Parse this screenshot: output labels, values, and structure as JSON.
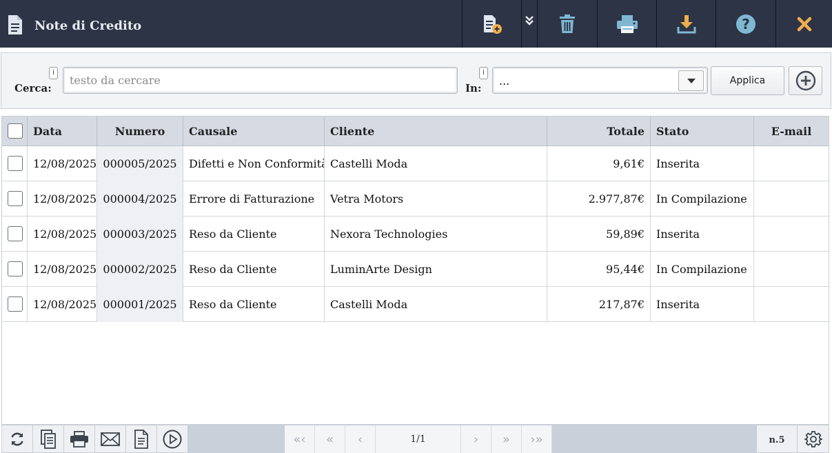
{
  "header": {
    "title": "Note di Credito",
    "icons": [
      "document-icon",
      "new-document-icon",
      "expand-more-icon",
      "trash-icon",
      "print-icon",
      "download-icon",
      "help-icon",
      "close-icon"
    ]
  },
  "search": {
    "cerca_label": "Cerca:",
    "in_label": "In:",
    "info_glyph": "i",
    "placeholder": "testo da cercare",
    "value": "",
    "in_value": "...",
    "apply_label": "Applica"
  },
  "table": {
    "columns": [
      "Data",
      "Numero",
      "Causale",
      "Cliente",
      "Totale",
      "Stato",
      "E-mail"
    ],
    "rows": [
      {
        "data": "12/08/2025",
        "numero": "000005/2025",
        "causale": "Difetti e Non Conformità",
        "cliente": "Castelli Moda",
        "totale": "9,61€",
        "stato": "Inserita",
        "email": ""
      },
      {
        "data": "12/08/2025",
        "numero": "000004/2025",
        "causale": "Errore di Fatturazione",
        "cliente": "Vetra Motors",
        "totale": "2.977,87€",
        "stato": "In Compilazione",
        "email": ""
      },
      {
        "data": "12/08/2025",
        "numero": "000003/2025",
        "causale": "Reso da Cliente",
        "cliente": "Nexora Technologies",
        "totale": "59,89€",
        "stato": "Inserita",
        "email": ""
      },
      {
        "data": "12/08/2025",
        "numero": "000002/2025",
        "causale": "Reso da Cliente",
        "cliente": "LuminArte Design",
        "totale": "95,44€",
        "stato": "In Compilazione",
        "email": ""
      },
      {
        "data": "12/08/2025",
        "numero": "000001/2025",
        "causale": "Reso da Cliente",
        "cliente": "Castelli Moda",
        "totale": "217,87€",
        "stato": "Inserita",
        "email": ""
      }
    ]
  },
  "footer": {
    "page": "1/1",
    "count": "n.5",
    "pager_glyphs": {
      "first": "«‹",
      "prev_fast": "«",
      "prev": "‹",
      "next": "›",
      "next_fast": "»",
      "last": "›»"
    }
  },
  "colors": {
    "titlebar": "#2c3446",
    "title_text": "#e8ecf2",
    "trash": "#7fb7d2",
    "print": "#7fb7d2",
    "download": "#f0ad4e",
    "help": "#7fb7d2",
    "close": "#f0ad4e",
    "header_row": "#d6dbe3"
  }
}
